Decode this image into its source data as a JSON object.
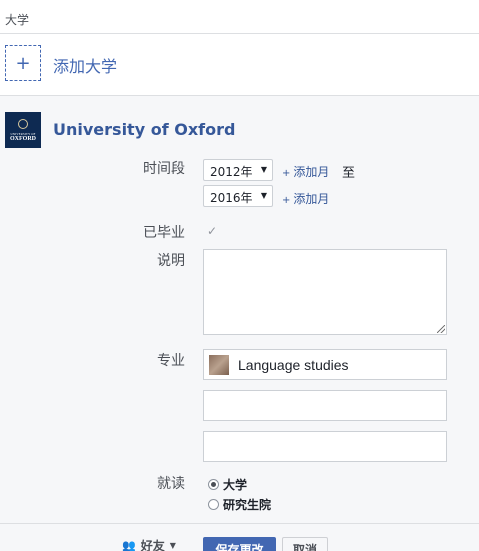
{
  "section": {
    "title": "大学"
  },
  "add": {
    "icon": "+",
    "label": "添加大学"
  },
  "school": {
    "name": "University of Oxford",
    "logo": {
      "small_text": "UNIVERSITY OF",
      "big_text": "OXFORD"
    }
  },
  "form": {
    "period_label": "时间段",
    "start_year": "2012年",
    "end_year": "2016年",
    "add_month": "添加月",
    "to": "至",
    "graduated_label": "已毕业",
    "graduated_checked": true,
    "description_label": "说明",
    "description_value": "",
    "major_label": "专业",
    "major_value": "Language studies",
    "major_2_value": "",
    "major_3_value": "",
    "attended_label": "就读",
    "attended_options": [
      "大学",
      "研究生院"
    ],
    "attended_selected": "大学"
  },
  "footer": {
    "privacy_label": "好友",
    "save_label": "保存更改",
    "cancel_label": "取消"
  },
  "colors": {
    "link": "#365899",
    "accent": "#4267b2",
    "panel_bg": "#f6f7f9"
  }
}
